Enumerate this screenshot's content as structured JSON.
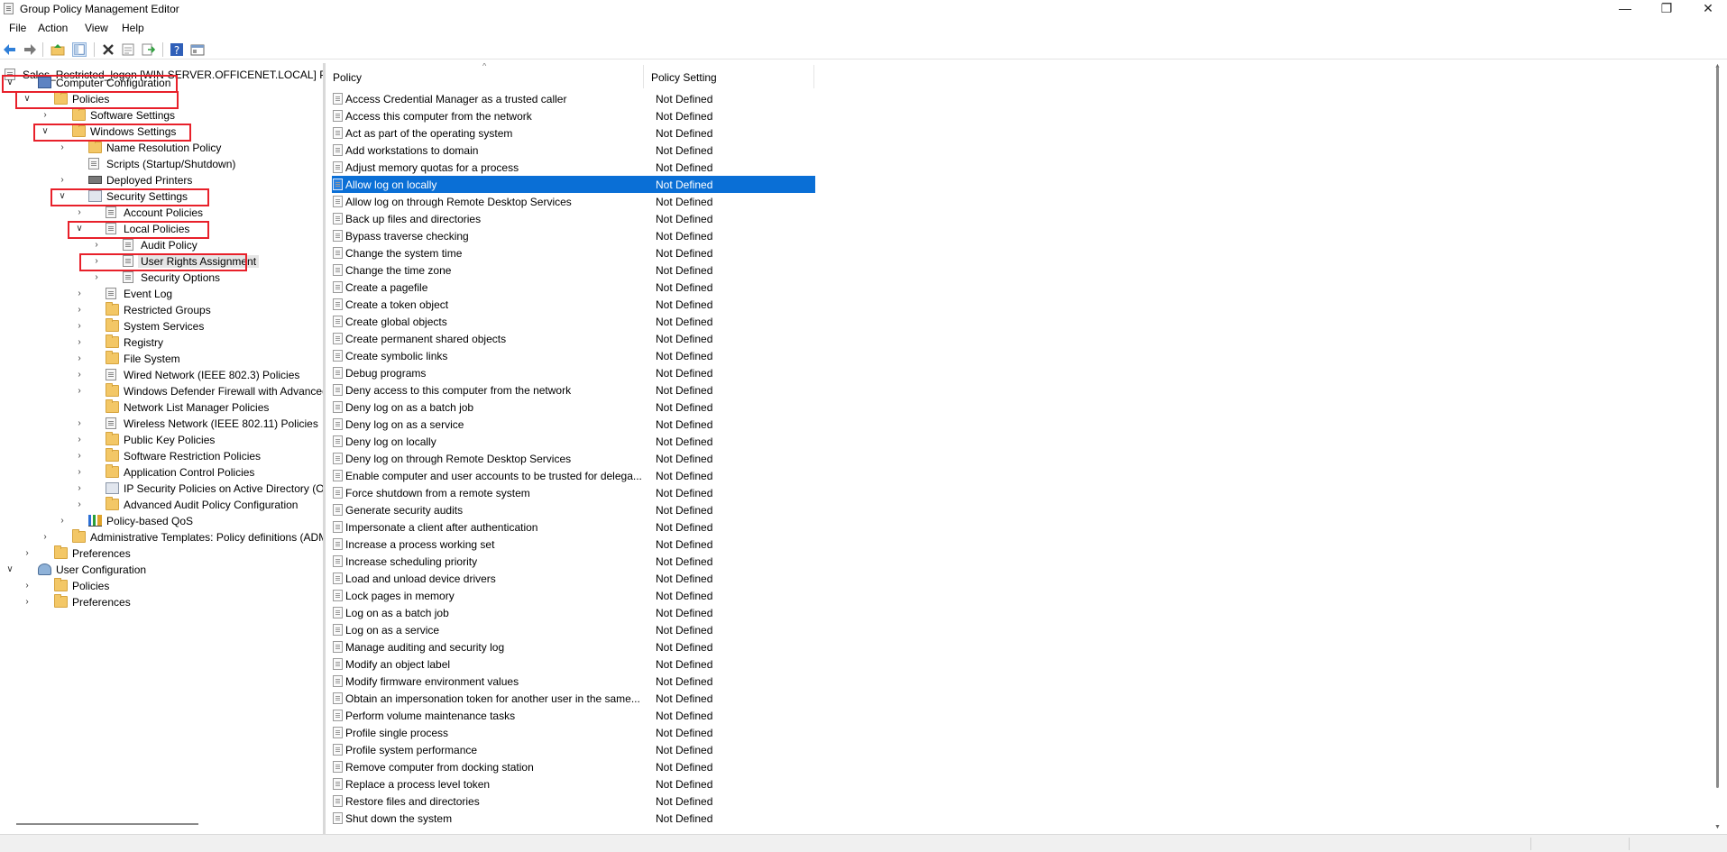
{
  "window": {
    "title": "Group Policy Management Editor",
    "minimize": "—",
    "maximize": "❐",
    "close": "✕"
  },
  "menu": [
    "File",
    "Action",
    "View",
    "Help"
  ],
  "toolbar": [
    "back-arrow-icon",
    "forward-arrow-icon",
    "up-folder-icon",
    "show-hide-tree-icon",
    "delete-icon",
    "properties-icon",
    "export-list-icon",
    "help-icon",
    "console-tree-icon"
  ],
  "tree": {
    "root_label": "Sales_Restricted_logon [WIN-SERVER.OFFICENET.LOCAL] Policy",
    "items": [
      {
        "label": "Computer Configuration",
        "chev": "v",
        "icon": "comp"
      },
      {
        "label": "Policies",
        "chev": "v",
        "icon": "folder"
      },
      {
        "label": "Software Settings",
        "chev": ">",
        "icon": "folder"
      },
      {
        "label": "Windows Settings",
        "chev": "v",
        "icon": "folder"
      },
      {
        "label": "Name Resolution Policy",
        "chev": ">",
        "icon": "folder"
      },
      {
        "label": "Scripts (Startup/Shutdown)",
        "chev": "",
        "icon": "doc"
      },
      {
        "label": "Deployed Printers",
        "chev": ">",
        "icon": "printer"
      },
      {
        "label": "Security Settings",
        "chev": "v",
        "icon": "shield"
      },
      {
        "label": "Account Policies",
        "chev": ">",
        "icon": "doc"
      },
      {
        "label": "Local Policies",
        "chev": "v",
        "icon": "doc"
      },
      {
        "label": "Audit Policy",
        "chev": ">",
        "icon": "doc"
      },
      {
        "label": "User Rights Assignment",
        "chev": ">",
        "icon": "doc"
      },
      {
        "label": "Security Options",
        "chev": ">",
        "icon": "doc"
      },
      {
        "label": "Event Log",
        "chev": ">",
        "icon": "doc"
      },
      {
        "label": "Restricted Groups",
        "chev": ">",
        "icon": "folder"
      },
      {
        "label": "System Services",
        "chev": ">",
        "icon": "folder"
      },
      {
        "label": "Registry",
        "chev": ">",
        "icon": "folder"
      },
      {
        "label": "File System",
        "chev": ">",
        "icon": "folder"
      },
      {
        "label": "Wired Network (IEEE 802.3) Policies",
        "chev": ">",
        "icon": "doc"
      },
      {
        "label": "Windows Defender Firewall with Advanced Se",
        "chev": ">",
        "icon": "folder"
      },
      {
        "label": "Network List Manager Policies",
        "chev": "",
        "icon": "folder"
      },
      {
        "label": "Wireless Network (IEEE 802.11) Policies",
        "chev": ">",
        "icon": "doc"
      },
      {
        "label": "Public Key Policies",
        "chev": ">",
        "icon": "folder"
      },
      {
        "label": "Software Restriction Policies",
        "chev": ">",
        "icon": "folder"
      },
      {
        "label": "Application Control Policies",
        "chev": ">",
        "icon": "folder"
      },
      {
        "label": "IP Security Policies on Active Directory (OFFIC",
        "chev": ">",
        "icon": "shield"
      },
      {
        "label": "Advanced Audit Policy Configuration",
        "chev": ">",
        "icon": "folder"
      },
      {
        "label": "Policy-based QoS",
        "chev": ">",
        "icon": "chart"
      },
      {
        "label": "Administrative Templates: Policy definitions (ADMX",
        "chev": ">",
        "icon": "folder"
      },
      {
        "label": "Preferences",
        "chev": ">",
        "icon": "folder"
      },
      {
        "label": "User Configuration",
        "chev": "v",
        "icon": "user"
      },
      {
        "label": "Policies",
        "chev": ">",
        "icon": "folder"
      },
      {
        "label": "Preferences",
        "chev": ">",
        "icon": "folder"
      }
    ]
  },
  "list": {
    "columns": {
      "policy": "Policy",
      "setting": "Policy Setting"
    },
    "sort_indicator": "^",
    "selected_index": 5,
    "rows": [
      {
        "policy": "Access Credential Manager as a trusted caller",
        "setting": "Not Defined"
      },
      {
        "policy": "Access this computer from the network",
        "setting": "Not Defined"
      },
      {
        "policy": "Act as part of the operating system",
        "setting": "Not Defined"
      },
      {
        "policy": "Add workstations to domain",
        "setting": "Not Defined"
      },
      {
        "policy": "Adjust memory quotas for a process",
        "setting": "Not Defined"
      },
      {
        "policy": "Allow log on locally",
        "setting": "Not Defined"
      },
      {
        "policy": "Allow log on through Remote Desktop Services",
        "setting": "Not Defined"
      },
      {
        "policy": "Back up files and directories",
        "setting": "Not Defined"
      },
      {
        "policy": "Bypass traverse checking",
        "setting": "Not Defined"
      },
      {
        "policy": "Change the system time",
        "setting": "Not Defined"
      },
      {
        "policy": "Change the time zone",
        "setting": "Not Defined"
      },
      {
        "policy": "Create a pagefile",
        "setting": "Not Defined"
      },
      {
        "policy": "Create a token object",
        "setting": "Not Defined"
      },
      {
        "policy": "Create global objects",
        "setting": "Not Defined"
      },
      {
        "policy": "Create permanent shared objects",
        "setting": "Not Defined"
      },
      {
        "policy": "Create symbolic links",
        "setting": "Not Defined"
      },
      {
        "policy": "Debug programs",
        "setting": "Not Defined"
      },
      {
        "policy": "Deny access to this computer from the network",
        "setting": "Not Defined"
      },
      {
        "policy": "Deny log on as a batch job",
        "setting": "Not Defined"
      },
      {
        "policy": "Deny log on as a service",
        "setting": "Not Defined"
      },
      {
        "policy": "Deny log on locally",
        "setting": "Not Defined"
      },
      {
        "policy": "Deny log on through Remote Desktop Services",
        "setting": "Not Defined"
      },
      {
        "policy": "Enable computer and user accounts to be trusted for delega...",
        "setting": "Not Defined"
      },
      {
        "policy": "Force shutdown from a remote system",
        "setting": "Not Defined"
      },
      {
        "policy": "Generate security audits",
        "setting": "Not Defined"
      },
      {
        "policy": "Impersonate a client after authentication",
        "setting": "Not Defined"
      },
      {
        "policy": "Increase a process working set",
        "setting": "Not Defined"
      },
      {
        "policy": "Increase scheduling priority",
        "setting": "Not Defined"
      },
      {
        "policy": "Load and unload device drivers",
        "setting": "Not Defined"
      },
      {
        "policy": "Lock pages in memory",
        "setting": "Not Defined"
      },
      {
        "policy": "Log on as a batch job",
        "setting": "Not Defined"
      },
      {
        "policy": "Log on as a service",
        "setting": "Not Defined"
      },
      {
        "policy": "Manage auditing and security log",
        "setting": "Not Defined"
      },
      {
        "policy": "Modify an object label",
        "setting": "Not Defined"
      },
      {
        "policy": "Modify firmware environment values",
        "setting": "Not Defined"
      },
      {
        "policy": "Obtain an impersonation token for another user in the same...",
        "setting": "Not Defined"
      },
      {
        "policy": "Perform volume maintenance tasks",
        "setting": "Not Defined"
      },
      {
        "policy": "Profile single process",
        "setting": "Not Defined"
      },
      {
        "policy": "Profile system performance",
        "setting": "Not Defined"
      },
      {
        "policy": "Remove computer from docking station",
        "setting": "Not Defined"
      },
      {
        "policy": "Replace a process level token",
        "setting": "Not Defined"
      },
      {
        "policy": "Restore files and directories",
        "setting": "Not Defined"
      },
      {
        "policy": "Shut down the system",
        "setting": "Not Defined"
      }
    ]
  },
  "colors": {
    "selection": "#0a6fd6",
    "highlight_box": "#e8202a",
    "folder": "#f3c766"
  }
}
